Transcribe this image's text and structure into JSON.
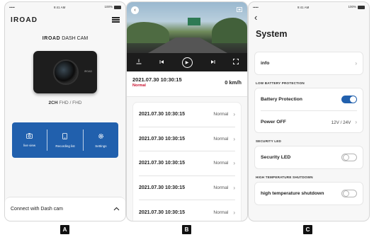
{
  "status_bar": {
    "time": "9:41 AM",
    "battery": "100%",
    "signal": "•••••"
  },
  "screen_a": {
    "logo": "IROAD",
    "product_brand": "IROAD",
    "product_name": "DASH CAM",
    "camera_logo": "IROAD",
    "resolution_channel": "2CH",
    "resolution_text": "FHD / FHD",
    "actions": [
      {
        "label": "live view",
        "icon": "camera-icon"
      },
      {
        "label": "Recording list",
        "icon": "phone-icon"
      },
      {
        "label": "Settings",
        "icon": "gear-icon"
      }
    ],
    "connect_label": "Connect with Dash cam"
  },
  "screen_b": {
    "current": {
      "datetime": "2021.07.30 10:30:15",
      "status": "Normal",
      "speed": "0 km/h"
    },
    "recordings": [
      {
        "datetime": "2021.07.30 10:30:15",
        "status": "Normal"
      },
      {
        "datetime": "2021.07.30 10:30:15",
        "status": "Normal"
      },
      {
        "datetime": "2021.07.30 10:30:15",
        "status": "Normal"
      },
      {
        "datetime": "2021.07.30 10:30:15",
        "status": "Normal"
      },
      {
        "datetime": "2021.07.30 10:30:15",
        "status": "Normal"
      }
    ]
  },
  "screen_c": {
    "title": "System",
    "info_label": "info",
    "low_battery_section": "LOW BATTERY PROTECTION",
    "battery_protection_label": "Battery Protection",
    "battery_protection_on": true,
    "power_off_label": "Power OFF",
    "power_off_value": "12V / 24V",
    "security_led_section": "SECURITY LED",
    "security_led_label": "Security LED",
    "security_led_on": false,
    "high_temp_section": "HIGH TEMPERATURE SHUTDOWN",
    "high_temp_label": "high temperature shutdown",
    "high_temp_on": false
  },
  "badges": [
    "A",
    "B",
    "C"
  ],
  "colors": {
    "accent": "#2160ad",
    "status_red": "#c8102e"
  }
}
